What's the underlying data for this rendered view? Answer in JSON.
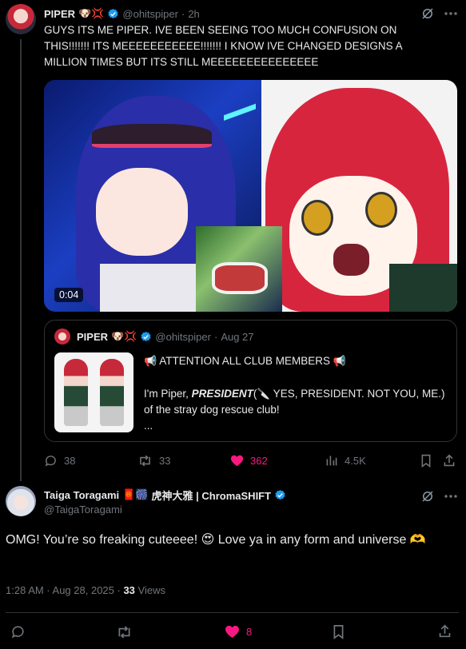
{
  "tweet": {
    "display_name": "PIPER",
    "name_emojis": "🐶💢",
    "handle": "@ohitspiper",
    "time": "2h",
    "text": "GUYS ITS ME PIPER. IVE BEEN SEEING TOO MUCH CONFUSION ON THIS!!!!!!! ITS MEEEEEEEEEEE!!!!!!! I KNOW IVE CHANGED DESIGNS A MILLION TIMES BUT ITS STILL MEEEEEEEEEEEEEEE",
    "video_duration": "0:04",
    "quote": {
      "display_name": "PIPER",
      "name_emojis": "🐶💢",
      "handle": "@ohitspiper",
      "time": "Aug 27",
      "line1_emoji_left": "📢",
      "line1_text": "ATTENTION ALL CLUB MEMBERS",
      "line1_emoji_right": "📢",
      "line2_pre": "I'm Piper, ",
      "line2_bold": "PRESIDENT",
      "line2_mid": "(🔪 YES, PRESIDENT. NOT YOU, ME.) of the stray dog rescue club!",
      "line3": "..."
    },
    "actions": {
      "replies": "38",
      "reposts": "33",
      "likes": "362",
      "views": "4.5K"
    }
  },
  "reply": {
    "display_name": "Taiga Toragami",
    "name_emojis": "🧧🎆",
    "name_suffix": "虎神大雅 | ChromaSHIFT",
    "handle": "@TaigaToragami",
    "text": "OMG! You’re so freaking cuteeee! 😍 Love ya in any form and universe 🫶",
    "timestamp": "1:28 AM · Aug 28, 2025 · ",
    "views_count": "33",
    "views_label": "Views",
    "actions": {
      "likes": "8"
    }
  },
  "colors": {
    "verified": "#1d9bf0",
    "like": "#f91880",
    "muted": "#71767b",
    "border": "#2f3336"
  }
}
